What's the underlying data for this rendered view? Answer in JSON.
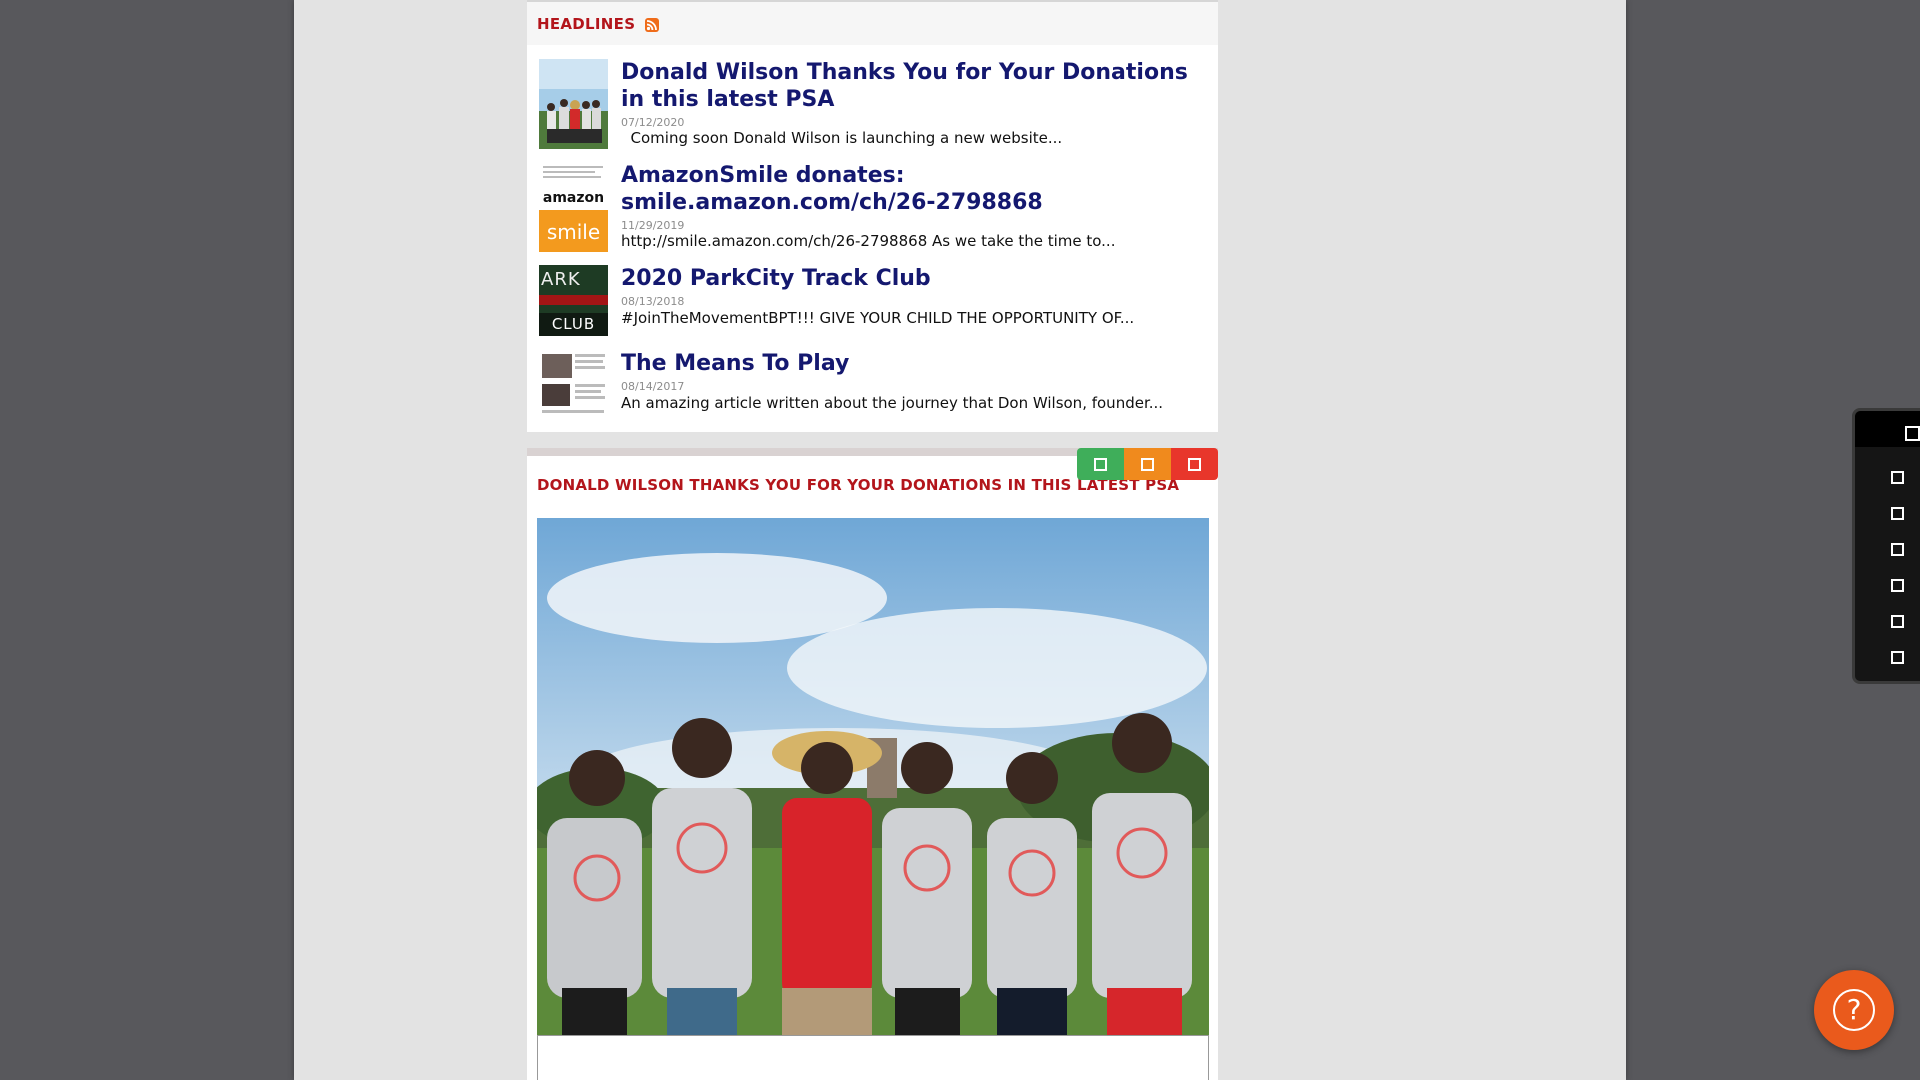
{
  "headlines": {
    "title": "HEADLINES",
    "rss_icon": "rss-icon",
    "items": [
      {
        "title": "Donald Wilson Thanks You for Your Donations in this latest PSA",
        "date": "07/12/2020",
        "snippet": "  Coming soon Donald Wilson is launching a new website..."
      },
      {
        "title": "AmazonSmile donates: smile.amazon.com/ch/26-2798868",
        "date": "11/29/2019",
        "snippet": "http://smile.amazon.com/ch/26-2798868 As we take the time to...",
        "thumb_text_top": "amazon",
        "thumb_text_bottom": "smile"
      },
      {
        "title": "2020 ParkCity Track Club",
        "date": "08/13/2018",
        "snippet": "#JoinTheMovementBPT!!!  GIVE YOUR CHILD THE OPPORTUNITY OF...",
        "thumb_text_top": "ARK",
        "thumb_text_bottom": "CLUB"
      },
      {
        "title": "The Means To Play",
        "date": "08/14/2017",
        "snippet": "An amazing article written about the journey that Don Wilson, founder..."
      }
    ]
  },
  "feature": {
    "title": "DONALD WILSON THANKS YOU FOR YOUR DONATIONS IN THIS LATEST PSA",
    "photo_alt": "group-photo"
  },
  "window_controls": {
    "colors": {
      "green": "#3fae5a",
      "orange": "#f08a1d",
      "red": "#e8362b"
    }
  },
  "help": {
    "label": "?"
  },
  "colors": {
    "background": "#58585c",
    "sheet": "#e3e3e3",
    "headline_link": "#14186f",
    "header_red": "#b3151b",
    "help_orange": "#ea5a1c"
  }
}
